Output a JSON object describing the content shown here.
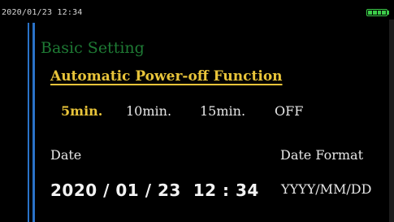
{
  "status_bar": {
    "datetime": "2020/01/23 12:34",
    "battery_color": "#3ccc4a"
  },
  "screen": {
    "section_title": "Basic Setting",
    "function_title": "Automatic Power-off Function",
    "options": [
      {
        "label": "5min.",
        "selected": true
      },
      {
        "label": "10min.",
        "selected": false
      },
      {
        "label": "15min.",
        "selected": false
      },
      {
        "label": "OFF",
        "selected": false
      }
    ],
    "date_label": "Date",
    "date_format_label": "Date Format",
    "date_value": "2020 / 01 / 23  12 : 34",
    "date_format_value": "YYYY/MM/DD"
  },
  "colors": {
    "accent": "#2a72c8",
    "selected": "#e8c43a",
    "section": "#1e7a34"
  }
}
